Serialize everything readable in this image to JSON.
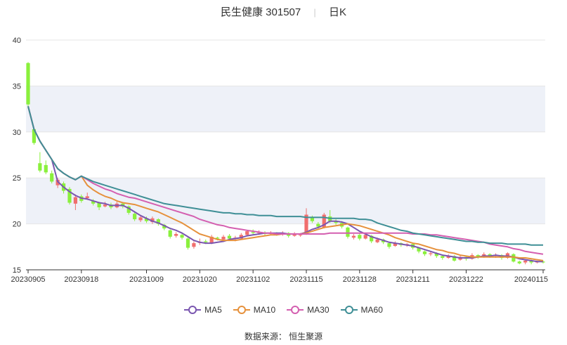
{
  "title": {
    "name": "民生健康 301507",
    "period": "日K"
  },
  "source_label": "数据来源：",
  "source_name": "恒生聚源",
  "colors": {
    "up": "#f06e6e",
    "down": "#8af03c",
    "ma5": "#7a56b0",
    "ma10": "#e6913c",
    "ma30": "#d45fb0",
    "ma60": "#3f8f96",
    "band": "#eef1f8",
    "axis": "#333333",
    "grid": "#e6e6e6"
  },
  "legend": [
    {
      "name": "MA5",
      "color_key": "ma5"
    },
    {
      "name": "MA10",
      "color_key": "ma10"
    },
    {
      "name": "MA30",
      "color_key": "ma30"
    },
    {
      "name": "MA60",
      "color_key": "ma60"
    }
  ],
  "chart_data": {
    "type": "candlestick",
    "ylim": [
      15,
      40
    ],
    "y_ticks": [
      15,
      20,
      25,
      30,
      35,
      40
    ],
    "x_tick_labels": [
      "20230905",
      "20230918",
      "20231009",
      "20231020",
      "20231102",
      "20231115",
      "20231128",
      "20231211",
      "20231222",
      "20240115"
    ],
    "x_tick_index": [
      0,
      9,
      20,
      29,
      38,
      47,
      56,
      65,
      74,
      87
    ],
    "grid": true,
    "candles": [
      [
        37.5,
        33.0,
        37.6,
        32.8
      ],
      [
        30.3,
        28.8,
        30.4,
        28.6
      ],
      [
        26.6,
        25.8,
        27.8,
        25.6
      ],
      [
        26.4,
        25.6,
        26.9,
        25.4
      ],
      [
        25.5,
        24.6,
        25.8,
        24.4
      ],
      [
        24.2,
        24.8,
        25.0,
        23.9
      ],
      [
        24.4,
        23.6,
        24.6,
        23.3
      ],
      [
        23.8,
        22.3,
        24.0,
        22.1
      ],
      [
        22.2,
        22.9,
        23.2,
        21.5
      ],
      [
        23.0,
        22.5,
        23.2,
        22.3
      ],
      [
        22.8,
        23.0,
        23.4,
        22.6
      ],
      [
        22.5,
        22.2,
        22.7,
        22.0
      ],
      [
        22.3,
        21.8,
        22.4,
        21.5
      ],
      [
        21.9,
        22.1,
        22.4,
        21.8
      ],
      [
        22.1,
        21.8,
        22.3,
        21.6
      ],
      [
        21.8,
        22.2,
        22.4,
        21.7
      ],
      [
        22.2,
        21.9,
        22.3,
        21.7
      ],
      [
        21.9,
        21.2,
        22.0,
        21.0
      ],
      [
        21.1,
        20.5,
        21.3,
        20.3
      ],
      [
        20.4,
        20.7,
        20.9,
        20.2
      ],
      [
        20.6,
        20.3,
        20.8,
        20.1
      ],
      [
        20.2,
        20.6,
        20.8,
        20.0
      ],
      [
        20.5,
        20.0,
        20.6,
        19.8
      ],
      [
        19.9,
        19.5,
        20.0,
        19.3
      ],
      [
        19.3,
        18.6,
        19.4,
        18.4
      ],
      [
        18.7,
        18.9,
        19.1,
        18.5
      ],
      [
        18.8,
        18.5,
        19.0,
        18.3
      ],
      [
        18.4,
        17.4,
        18.5,
        17.2
      ],
      [
        17.5,
        17.9,
        18.1,
        17.3
      ],
      [
        18.0,
        18.0,
        18.4,
        17.7
      ],
      [
        18.1,
        18.0,
        18.3,
        17.8
      ],
      [
        17.9,
        18.6,
        18.8,
        17.8
      ],
      [
        18.5,
        18.4,
        18.6,
        18.2
      ],
      [
        18.3,
        18.6,
        18.8,
        18.1
      ],
      [
        18.7,
        18.4,
        18.9,
        18.2
      ],
      [
        18.4,
        18.5,
        18.7,
        18.1
      ],
      [
        18.4,
        18.8,
        19.0,
        18.3
      ],
      [
        18.8,
        19.2,
        19.3,
        18.7
      ],
      [
        19.1,
        19.0,
        19.4,
        18.8
      ],
      [
        19.0,
        19.1,
        19.3,
        18.8
      ],
      [
        19.0,
        18.9,
        19.2,
        18.7
      ],
      [
        18.9,
        19.0,
        19.2,
        18.8
      ],
      [
        19.0,
        18.9,
        19.1,
        18.7
      ],
      [
        18.9,
        19.0,
        19.2,
        18.7
      ],
      [
        19.0,
        18.7,
        19.1,
        18.5
      ],
      [
        18.7,
        18.9,
        19.1,
        18.6
      ],
      [
        18.8,
        18.8,
        19.0,
        18.6
      ],
      [
        18.9,
        21.0,
        21.7,
        18.8
      ],
      [
        20.7,
        20.3,
        20.9,
        20.1
      ],
      [
        20.0,
        19.7,
        20.2,
        19.5
      ],
      [
        19.6,
        21.0,
        21.2,
        19.5
      ],
      [
        20.8,
        20.3,
        21.5,
        20.1
      ],
      [
        20.3,
        20.1,
        20.5,
        19.9
      ],
      [
        20.1,
        19.7,
        20.3,
        19.5
      ],
      [
        19.6,
        18.6,
        19.7,
        18.4
      ],
      [
        18.5,
        18.7,
        18.9,
        18.3
      ],
      [
        18.8,
        18.4,
        19.0,
        18.2
      ],
      [
        18.4,
        18.8,
        19.0,
        18.3
      ],
      [
        18.7,
        18.1,
        18.8,
        17.9
      ],
      [
        18.0,
        18.3,
        18.5,
        17.9
      ],
      [
        18.3,
        18.0,
        18.4,
        17.8
      ],
      [
        17.9,
        17.5,
        18.0,
        17.3
      ],
      [
        17.6,
        17.9,
        18.1,
        17.5
      ],
      [
        17.9,
        17.7,
        18.0,
        17.5
      ],
      [
        17.7,
        17.8,
        17.9,
        17.5
      ],
      [
        17.8,
        17.4,
        17.9,
        17.2
      ],
      [
        17.4,
        17.0,
        17.5,
        16.8
      ],
      [
        17.0,
        16.7,
        17.1,
        16.5
      ],
      [
        16.7,
        16.8,
        17.0,
        16.5
      ],
      [
        16.8,
        16.5,
        16.9,
        16.3
      ],
      [
        16.5,
        16.3,
        16.6,
        16.1
      ],
      [
        16.3,
        16.5,
        16.7,
        16.2
      ],
      [
        16.5,
        16.0,
        16.6,
        15.9
      ],
      [
        16.1,
        16.4,
        16.6,
        16.0
      ],
      [
        16.4,
        16.2,
        16.5,
        16.0
      ],
      [
        16.2,
        16.6,
        16.8,
        16.1
      ],
      [
        16.6,
        16.4,
        16.7,
        16.2
      ],
      [
        16.4,
        16.7,
        16.9,
        16.3
      ],
      [
        16.7,
        16.5,
        16.8,
        16.3
      ],
      [
        16.5,
        16.6,
        16.8,
        16.3
      ],
      [
        16.6,
        16.3,
        16.7,
        16.1
      ],
      [
        16.3,
        16.8,
        16.9,
        16.2
      ],
      [
        16.7,
        15.9,
        16.8,
        15.8
      ],
      [
        15.9,
        15.7,
        16.0,
        15.6
      ],
      [
        15.8,
        16.0,
        16.1,
        15.6
      ],
      [
        16.0,
        15.8,
        16.1,
        15.6
      ],
      [
        15.8,
        15.9,
        16.0,
        15.7
      ],
      [
        15.9,
        15.8,
        16.0,
        15.7
      ]
    ],
    "series": [
      {
        "name": "MA5",
        "values": [
          32.8,
          30.3,
          29.0,
          28.0,
          27.0,
          24.6,
          24.0,
          23.5,
          23.1,
          22.8,
          22.7,
          22.5,
          22.3,
          22.2,
          22.0,
          22.0,
          22.0,
          21.7,
          21.3,
          20.9,
          20.6,
          20.3,
          20.1,
          19.8,
          19.5,
          19.3,
          19.0,
          18.6,
          18.2,
          18.0,
          17.9,
          17.9,
          18.0,
          18.1,
          18.3,
          18.4,
          18.5,
          18.7,
          18.8,
          18.9,
          19.0,
          19.0,
          19.0,
          19.0,
          18.9,
          18.9,
          18.9,
          19.1,
          19.4,
          19.6,
          19.9,
          20.3,
          20.3,
          20.2,
          20.0,
          19.6,
          19.2,
          18.9,
          18.6,
          18.4,
          18.2,
          18.0,
          17.9,
          17.8,
          17.7,
          17.6,
          17.4,
          17.2,
          17.0,
          16.8,
          16.6,
          16.5,
          16.4,
          16.3,
          16.3,
          16.3,
          16.4,
          16.5,
          16.5,
          16.6,
          16.5,
          16.5,
          16.4,
          16.2,
          16.1,
          16.0,
          15.9,
          15.9
        ]
      },
      {
        "name": "MA10",
        "values": [
          32.8,
          30.3,
          29.0,
          28.0,
          27.0,
          26.0,
          25.5,
          25.1,
          24.8,
          25.2,
          24.2,
          23.7,
          23.3,
          23.0,
          22.8,
          22.5,
          22.3,
          22.2,
          22.1,
          21.9,
          21.7,
          21.5,
          21.3,
          21.0,
          20.7,
          20.4,
          20.1,
          19.7,
          19.3,
          18.9,
          18.7,
          18.5,
          18.3,
          18.2,
          18.2,
          18.2,
          18.3,
          18.4,
          18.5,
          18.6,
          18.7,
          18.8,
          18.8,
          18.9,
          18.9,
          18.9,
          18.9,
          19.0,
          19.2,
          19.4,
          19.6,
          19.7,
          19.8,
          19.9,
          20.0,
          19.9,
          19.8,
          19.6,
          19.4,
          19.2,
          19.0,
          18.8,
          18.5,
          18.3,
          18.1,
          17.9,
          17.8,
          17.6,
          17.4,
          17.2,
          17.1,
          16.9,
          16.8,
          16.6,
          16.5,
          16.4,
          16.4,
          16.4,
          16.4,
          16.4,
          16.4,
          16.4,
          16.4,
          16.3,
          16.3,
          16.2,
          16.1,
          16.0
        ]
      },
      {
        "name": "MA30",
        "values": [
          32.8,
          30.3,
          29.0,
          28.0,
          27.0,
          26.0,
          25.5,
          25.1,
          24.8,
          25.2,
          24.8,
          24.4,
          24.1,
          23.8,
          23.6,
          23.3,
          23.1,
          22.9,
          22.8,
          22.6,
          22.4,
          22.2,
          22.0,
          21.8,
          21.6,
          21.4,
          21.2,
          21.0,
          20.8,
          20.5,
          20.3,
          20.1,
          19.9,
          19.8,
          19.6,
          19.5,
          19.4,
          19.3,
          19.2,
          19.1,
          19.0,
          19.0,
          18.9,
          18.9,
          18.9,
          18.9,
          18.9,
          18.9,
          18.9,
          18.9,
          18.9,
          19.0,
          19.0,
          19.0,
          19.0,
          19.0,
          19.0,
          19.0,
          19.0,
          19.0,
          19.0,
          19.0,
          19.0,
          19.0,
          19.0,
          18.9,
          18.9,
          18.9,
          18.8,
          18.8,
          18.7,
          18.6,
          18.5,
          18.4,
          18.3,
          18.2,
          18.1,
          18.0,
          17.8,
          17.7,
          17.6,
          17.5,
          17.3,
          17.2,
          17.0,
          16.9,
          16.8,
          16.7
        ]
      },
      {
        "name": "MA60",
        "values": [
          32.8,
          30.3,
          29.0,
          28.0,
          27.0,
          26.0,
          25.5,
          25.1,
          24.8,
          25.2,
          24.9,
          24.6,
          24.4,
          24.2,
          24.0,
          23.8,
          23.6,
          23.4,
          23.2,
          23.0,
          22.8,
          22.6,
          22.4,
          22.2,
          22.1,
          22.0,
          21.9,
          21.8,
          21.7,
          21.6,
          21.5,
          21.4,
          21.3,
          21.2,
          21.2,
          21.1,
          21.1,
          21.0,
          21.0,
          20.9,
          20.9,
          20.9,
          20.8,
          20.8,
          20.8,
          20.8,
          20.8,
          20.7,
          20.7,
          20.7,
          20.7,
          20.6,
          20.6,
          20.6,
          20.6,
          20.6,
          20.5,
          20.5,
          20.4,
          20.1,
          19.9,
          19.7,
          19.5,
          19.3,
          19.2,
          19.0,
          18.9,
          18.8,
          18.7,
          18.6,
          18.5,
          18.4,
          18.3,
          18.2,
          18.1,
          18.1,
          18.0,
          18.0,
          17.9,
          17.9,
          17.9,
          17.8,
          17.8,
          17.8,
          17.8,
          17.7,
          17.7,
          17.7
        ]
      }
    ]
  }
}
